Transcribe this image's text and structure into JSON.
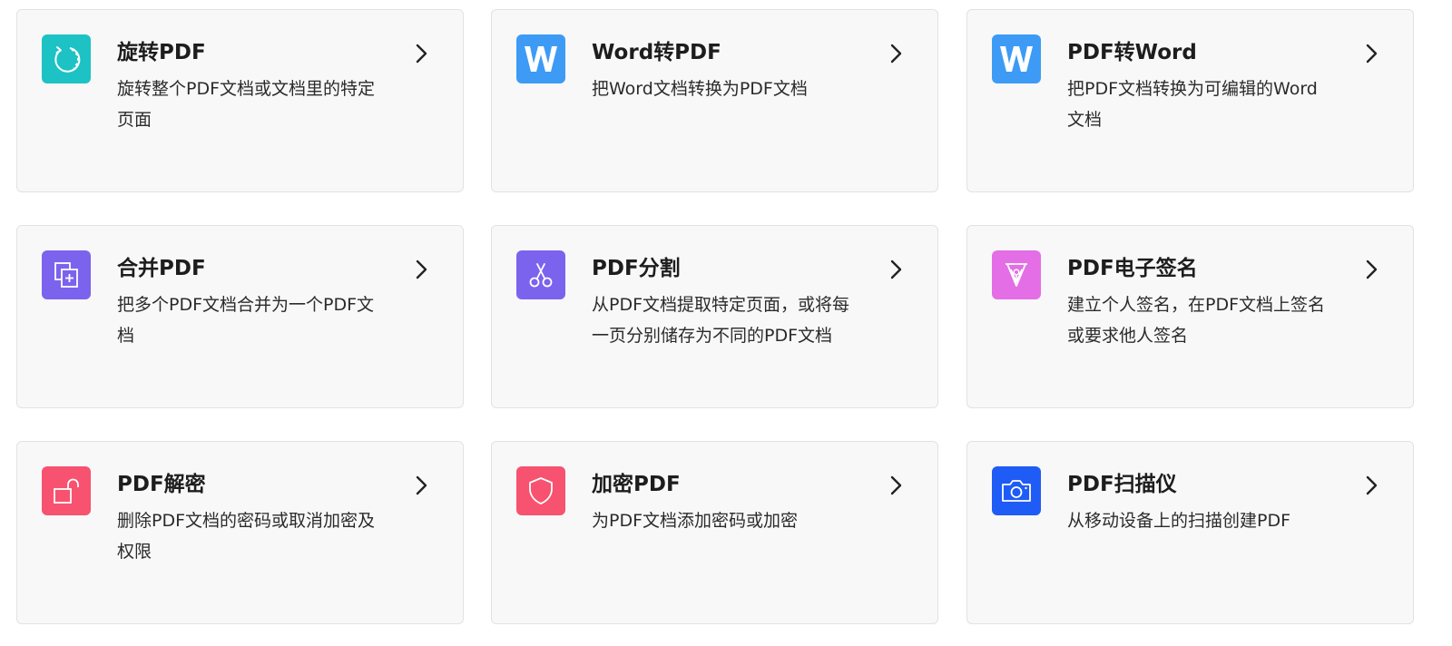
{
  "colors": {
    "teal": "#1cc2c4",
    "blue": "#3d9bf5",
    "purple": "#7b63ee",
    "pink": "#e46ee6",
    "red": "#f7526f",
    "darkblue": "#1f5cf5"
  },
  "cards": [
    {
      "title": "旋转PDF",
      "desc": "旋转整个PDF文档或文档里的特定页面",
      "icon": "rotate-icon",
      "color": "#1cc2c4"
    },
    {
      "title": "Word转PDF",
      "desc": "把Word文档转换为PDF文档",
      "icon": "word-icon",
      "color": "#3d9bf5"
    },
    {
      "title": "PDF转Word",
      "desc": "把PDF文档转换为可编辑的Word文档",
      "icon": "word-icon",
      "color": "#3d9bf5"
    },
    {
      "title": "合并PDF",
      "desc": "把多个PDF文档合并为一个PDF文档",
      "icon": "merge-icon",
      "color": "#7b63ee"
    },
    {
      "title": "PDF分割",
      "desc": "从PDF文档提取特定页面，或将每一页分别储存为不同的PDF文档",
      "icon": "scissors-icon",
      "color": "#7b63ee"
    },
    {
      "title": "PDF电子签名",
      "desc": "建立个人签名，在PDF文档上签名或要求他人签名",
      "icon": "pen-nib-icon",
      "color": "#e46ee6"
    },
    {
      "title": "PDF解密",
      "desc": "删除PDF文档的密码或取消加密及权限",
      "icon": "unlock-icon",
      "color": "#f7526f"
    },
    {
      "title": "加密PDF",
      "desc": "为PDF文档添加密码或加密",
      "icon": "shield-icon",
      "color": "#f7526f"
    },
    {
      "title": "PDF扫描仪",
      "desc": "从移动设备上的扫描创建PDF",
      "icon": "camera-icon",
      "color": "#1f5cf5"
    }
  ]
}
